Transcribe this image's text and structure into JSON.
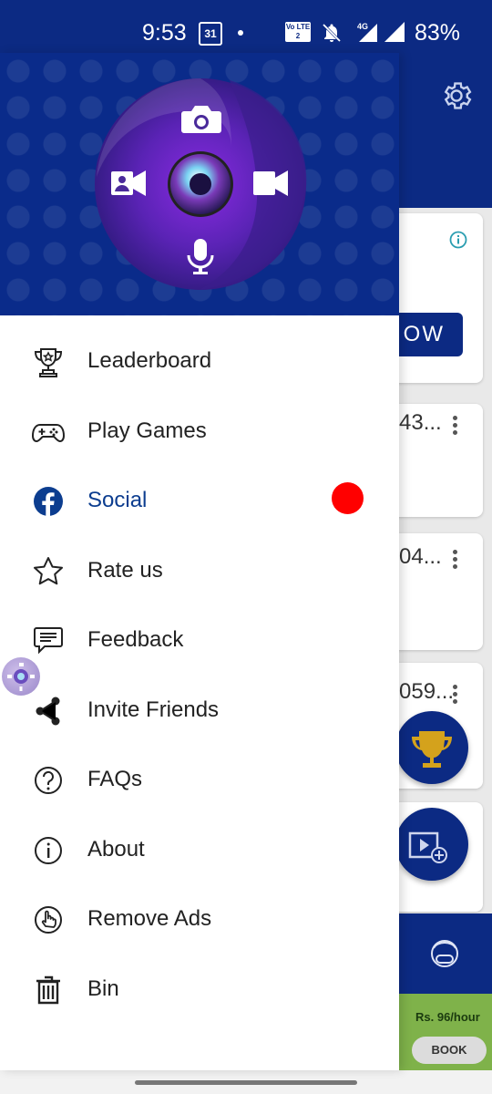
{
  "status_bar": {
    "time": "9:53",
    "calendar_day": "31",
    "volte": "Vo LTE 2",
    "network": "4G",
    "battery": "83%"
  },
  "drawer": {
    "menu": [
      {
        "label": "Leaderboard",
        "icon": "trophy-icon"
      },
      {
        "label": "Play Games",
        "icon": "gamepad-icon"
      },
      {
        "label": "Social",
        "icon": "facebook-icon",
        "active": true,
        "badge_color": "#ff0000"
      },
      {
        "label": "Rate us",
        "icon": "star-icon"
      },
      {
        "label": "Feedback",
        "icon": "feedback-icon"
      },
      {
        "label": "Invite Friends",
        "icon": "share-icon"
      },
      {
        "label": "FAQs",
        "icon": "help-icon"
      },
      {
        "label": "About",
        "icon": "info-icon"
      },
      {
        "label": "Remove Ads",
        "icon": "hand-pointer-icon"
      },
      {
        "label": "Bin",
        "icon": "trash-icon"
      }
    ]
  },
  "background_app": {
    "now_button": "OW",
    "card_titles": [
      "43...",
      "04...",
      "059..."
    ],
    "banner_price": "Rs. 96/hour",
    "banner_button": "BOOK"
  },
  "colors": {
    "brand_blue": "#0c2a83",
    "active_text": "#0c3d8f",
    "badge": "#ff0000"
  }
}
